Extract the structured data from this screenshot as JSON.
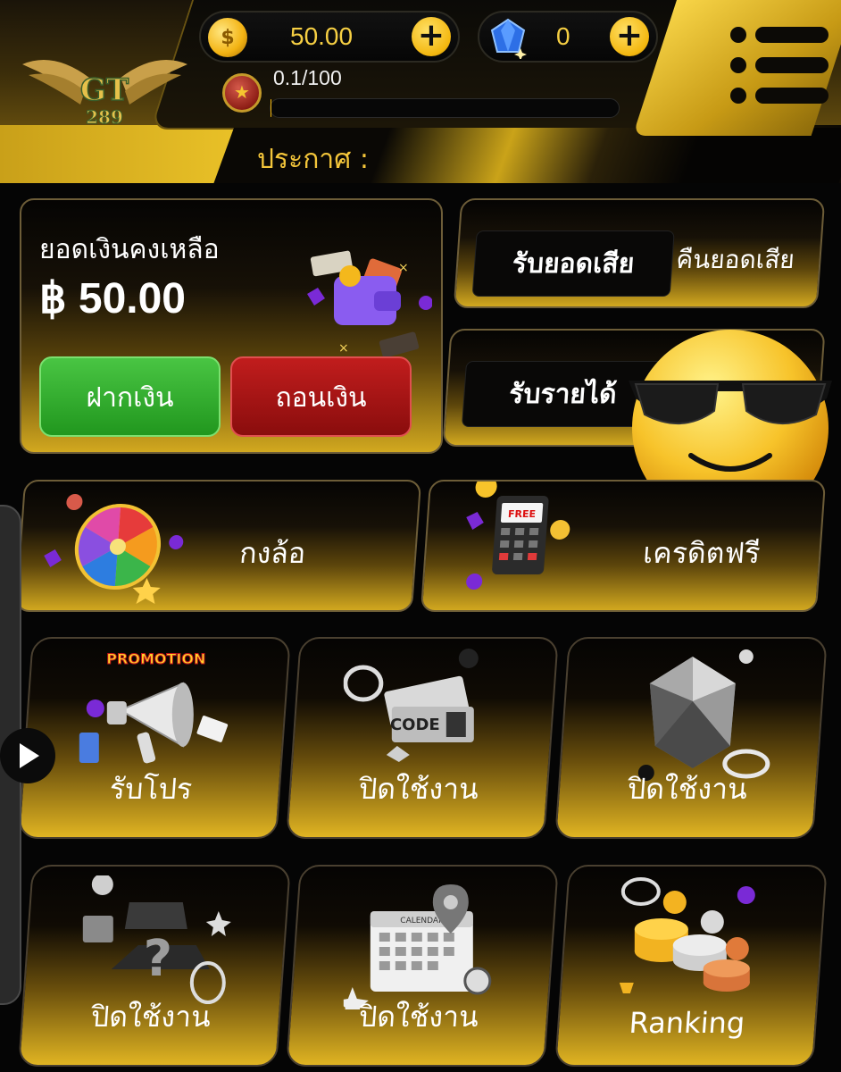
{
  "header": {
    "logo_text": "GT",
    "logo_number": "289",
    "coins": {
      "value": "50.00",
      "icon": "coin-icon"
    },
    "gems": {
      "value": "0",
      "icon": "gem-icon"
    },
    "level": {
      "icon": "star-icon",
      "exp_text": "0.1/100",
      "progress": 0.001
    },
    "notice_label": "ประกาศ :"
  },
  "balance": {
    "label": "ยอดเงินคงเหลือ",
    "amount": "฿ 50.00",
    "deposit_label": "ฝากเงิน",
    "withdraw_label": "ถอนเงิน"
  },
  "rebate": {
    "chip_label": "รับยอดเสีย",
    "text": "คืนยอดเสีย"
  },
  "income": {
    "chip_label": "รับรายได้"
  },
  "wide_tiles": [
    {
      "label": "กงล้อ",
      "icon": "prize-wheel-icon"
    },
    {
      "label": "เครดิตฟรี",
      "icon": "free-credit-calculator-icon",
      "badge": "FREE"
    }
  ],
  "tiles": [
    {
      "label": "รับโปร",
      "icon": "promotion-megaphone-icon",
      "badge": "PROMOTION"
    },
    {
      "label": "ปิดใช้งาน",
      "icon": "code-ticket-icon",
      "badge": "CODE"
    },
    {
      "label": "ปิดใช้งาน",
      "icon": "diamond-icon"
    },
    {
      "label": "ปิดใช้งาน",
      "icon": "mystery-box-icon"
    },
    {
      "label": "ปิดใช้งาน",
      "icon": "calendar-icon",
      "badge": "CALENDAR"
    },
    {
      "label": "Ranking",
      "icon": "ranking-podium-icon"
    }
  ],
  "colors": {
    "gold": "#f1c92b",
    "deposit": "#2fae2a",
    "withdraw": "#b01515",
    "background": "#050505"
  }
}
